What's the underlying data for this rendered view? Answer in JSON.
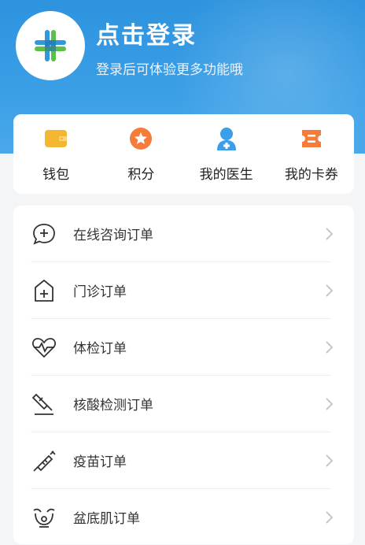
{
  "profile": {
    "login_title": "点击登录",
    "login_subtitle": "登录后可体验更多功能哦",
    "avatar_icon": "app-logo-icon"
  },
  "quick_actions": [
    {
      "label": "钱包",
      "icon": "wallet-icon",
      "color": "#f5b731"
    },
    {
      "label": "积分",
      "icon": "points-star-icon",
      "color": "#f57c3a"
    },
    {
      "label": "我的医生",
      "icon": "doctor-icon",
      "color": "#3a9ee8"
    },
    {
      "label": "我的卡券",
      "icon": "coupon-icon",
      "color": "#f57c3a"
    }
  ],
  "orders": [
    {
      "label": "在线咨询订单",
      "icon": "chat-plus-icon"
    },
    {
      "label": "门诊订单",
      "icon": "clinic-icon"
    },
    {
      "label": "体检订单",
      "icon": "heartbeat-icon"
    },
    {
      "label": "核酸检测订单",
      "icon": "swab-test-icon"
    },
    {
      "label": "疫苗订单",
      "icon": "syringe-icon"
    },
    {
      "label": "盆底肌订单",
      "icon": "pelvic-icon"
    }
  ],
  "colors": {
    "header_blue": "#2d93de",
    "background": "#f4f5f7",
    "chevron": "#c8c8c8"
  }
}
